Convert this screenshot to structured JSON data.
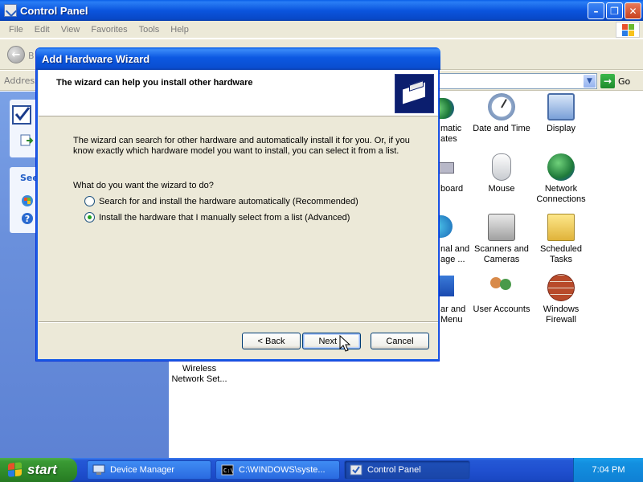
{
  "window": {
    "title": "Control Panel",
    "menu": [
      "File",
      "Edit",
      "View",
      "Favorites",
      "Tools",
      "Help"
    ],
    "toolbar": {
      "back_label": "B"
    },
    "address": {
      "label": "Address",
      "go_label": "Go"
    }
  },
  "left_pane": {
    "see_also_fragment": "See"
  },
  "items": [
    {
      "label": "Date and Time",
      "icon": "clock-icon"
    },
    {
      "label": "Display",
      "icon": "monitor-icon"
    },
    {
      "label": "Mouse",
      "icon": "mouse-icon"
    },
    {
      "label": "Network Connections",
      "icon": "network-globe-icon"
    },
    {
      "label": "Scanners and Cameras",
      "icon": "scanner-camera-icon"
    },
    {
      "label": "Scheduled Tasks",
      "icon": "folder-clock-icon"
    },
    {
      "label": "User Accounts",
      "icon": "users-icon"
    },
    {
      "label": "Windows Firewall",
      "icon": "firewall-icon"
    },
    {
      "label": "Wireless Network Set...",
      "icon": "wireless-icon"
    }
  ],
  "partial_items": [
    {
      "line1": "matic",
      "line2": "ates"
    },
    {
      "line1": "board",
      "line2": ""
    },
    {
      "line1": "nal and",
      "line2": "age ..."
    },
    {
      "line1": "ar and",
      "line2": "Menu"
    }
  ],
  "dialog": {
    "title": "Add Hardware Wizard",
    "heading": "The wizard can help you install other hardware",
    "description": "The wizard can search for other hardware and automatically install it for you. Or, if you know exactly which hardware model you want to install, you can select it from a list.",
    "question": "What do you want the wizard to do?",
    "options": [
      {
        "label": "Search for and install the hardware automatically (Recommended)",
        "checked": false
      },
      {
        "label": "Install the hardware that I manually select from a list (Advanced)",
        "checked": true
      }
    ],
    "buttons": {
      "back": "< Back",
      "next": "Next >",
      "cancel": "Cancel"
    }
  },
  "taskbar": {
    "start_label": "start",
    "tasks": [
      {
        "label": "Device Manager",
        "active": false
      },
      {
        "label": "C:\\WINDOWS\\syste...",
        "active": false
      },
      {
        "label": "Control Panel",
        "active": true
      }
    ],
    "clock": "7:04 PM"
  },
  "colors": {
    "titlebar": "#0a5fe8",
    "dialog_face": "#ece9d8",
    "radio_dot": "#21a121",
    "start_green": "#3a9a34",
    "taskbar_blue": "#2458d6"
  }
}
